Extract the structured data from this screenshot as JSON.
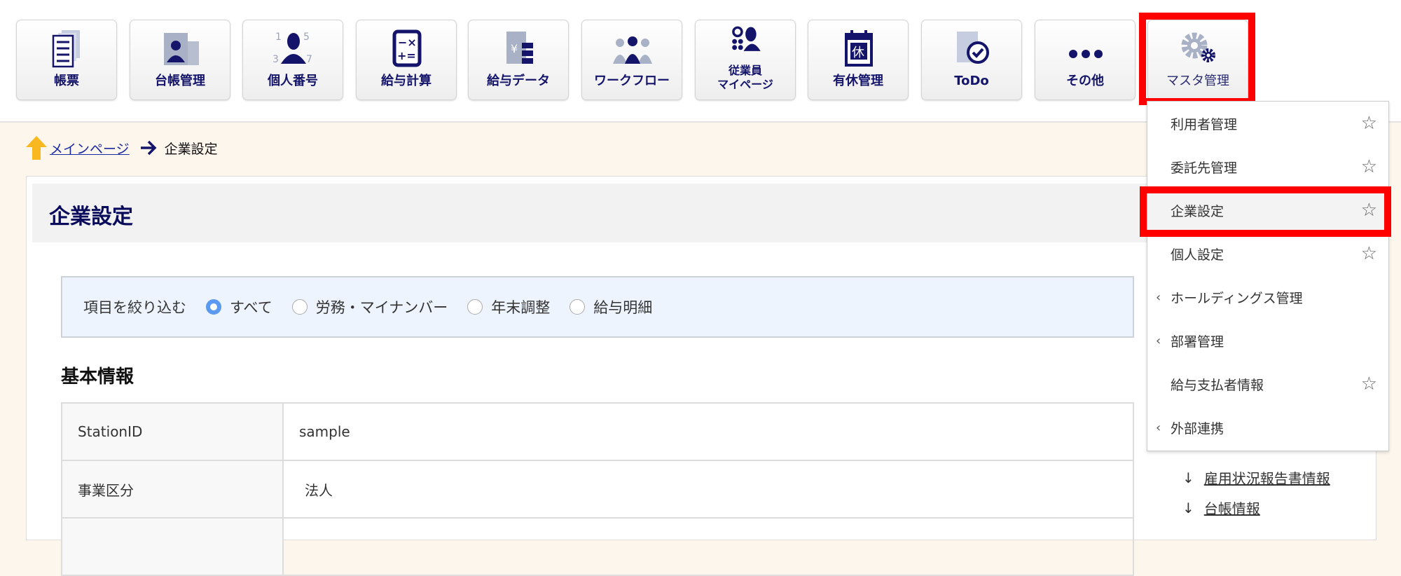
{
  "nav": [
    {
      "label": "帳票",
      "icon": "document-stack-icon"
    },
    {
      "label": "台帳管理",
      "icon": "id-card-icon"
    },
    {
      "label": "個人番号",
      "icon": "person-number-icon"
    },
    {
      "label": "給与計算",
      "icon": "calculator-icon"
    },
    {
      "label": "給与データ",
      "icon": "yen-data-icon"
    },
    {
      "label": "ワークフロー",
      "icon": "people-workflow-icon"
    },
    {
      "label1": "従業員",
      "label2": "マイページ",
      "icon": "employee-page-icon"
    },
    {
      "label": "有休管理",
      "icon": "calendar-leave-icon",
      "glyph": "休"
    },
    {
      "label": "ToDo",
      "icon": "todo-check-icon"
    },
    {
      "label": "その他",
      "icon": "more-dots-icon"
    },
    {
      "label": "マスタ管理",
      "icon": "gears-icon"
    }
  ],
  "breadcrumb": {
    "home": "メインページ",
    "current": "企業設定"
  },
  "page_title": "企業設定",
  "filter": {
    "label": "項目を絞り込む",
    "options": [
      "すべて",
      "労務・マイナンバー",
      "年末調整",
      "給与明細"
    ],
    "selected": "すべて"
  },
  "section_title": "基本情報",
  "table": [
    {
      "key": "StationID",
      "value": "sample"
    },
    {
      "key": "事業区分",
      "value": "法人"
    }
  ],
  "side_links": [
    "雇用状況報告書情報",
    "台帳情報"
  ],
  "dropdown": [
    {
      "label": "利用者管理",
      "star": true,
      "sub": false
    },
    {
      "label": "委託先管理",
      "star": true,
      "sub": false
    },
    {
      "label": "企業設定",
      "star": true,
      "sub": false,
      "active": true
    },
    {
      "label": "個人設定",
      "star": true,
      "sub": false
    },
    {
      "label": "ホールディングス管理",
      "star": false,
      "sub": true
    },
    {
      "label": "部署管理",
      "star": false,
      "sub": true
    },
    {
      "label": "給与支払者情報",
      "star": true,
      "sub": false
    },
    {
      "label": "外部連携",
      "star": false,
      "sub": true
    }
  ],
  "colors": {
    "navy": "#14146a",
    "highlight": "#ff0000",
    "radio": "#5b9af0"
  }
}
